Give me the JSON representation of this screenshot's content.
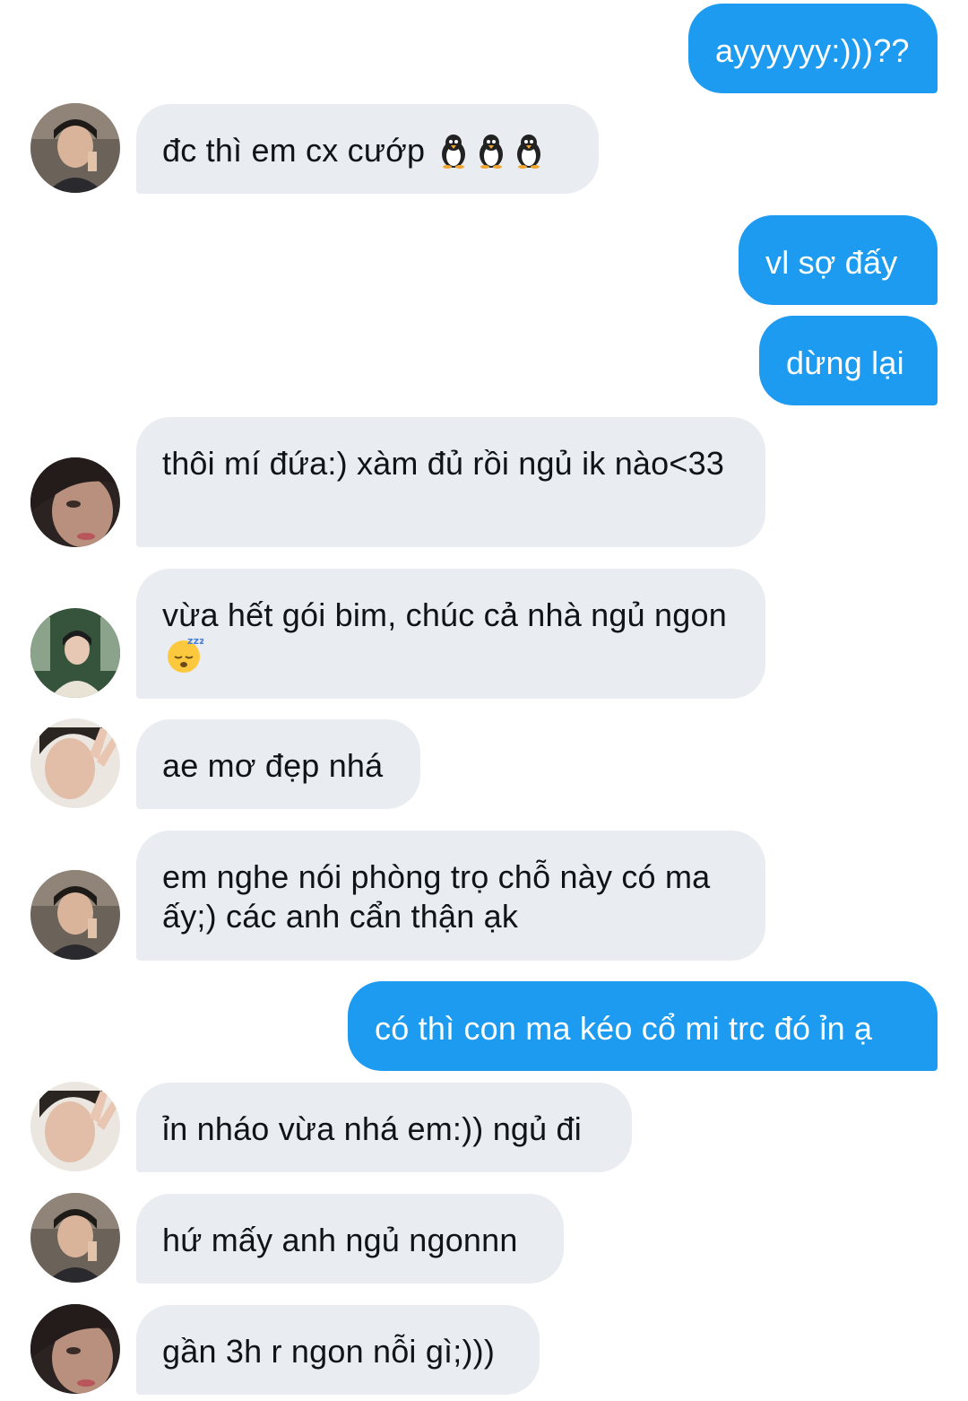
{
  "conversation": {
    "messages": [
      {
        "id": 1,
        "direction": "sent",
        "text": "ayyyyyy:)))??"
      },
      {
        "id": 2,
        "direction": "received",
        "text": "đc thì em cx cướp",
        "emoji": [
          "penguin",
          "penguin",
          "penguin"
        ],
        "avatar": "avatar-a"
      },
      {
        "id": 3,
        "direction": "sent",
        "text": "vl sợ đấy"
      },
      {
        "id": 4,
        "direction": "sent",
        "text": "dừng lại"
      },
      {
        "id": 5,
        "direction": "received",
        "text": "thôi mí đứa:) xàm đủ rồi ngủ ik nào<33",
        "avatar": "avatar-b"
      },
      {
        "id": 6,
        "direction": "received",
        "text": "vừa hết gói bim, chúc cả nhà ngủ ngon",
        "emoji": [
          "sleeping-face"
        ],
        "avatar": "avatar-c"
      },
      {
        "id": 7,
        "direction": "received",
        "text": "ae mơ đẹp nhá",
        "avatar": "avatar-d"
      },
      {
        "id": 8,
        "direction": "received",
        "text": "em nghe nói phòng trọ chỗ này có ma ấy;) các anh cẩn thận ạk",
        "avatar": "avatar-a"
      },
      {
        "id": 9,
        "direction": "sent",
        "text": "có thì con ma kéo cổ mi trc đó ỉn ạ"
      },
      {
        "id": 10,
        "direction": "received",
        "text": "ỉn nháo vừa nhá em:)) ngủ đi",
        "avatar": "avatar-d"
      },
      {
        "id": 11,
        "direction": "received",
        "text": "hứ mấy anh ngủ ngonnn",
        "avatar": "avatar-a"
      },
      {
        "id": 12,
        "direction": "received",
        "text": "gần 3h r ngon nỗi gì;)))",
        "avatar": "avatar-b"
      }
    ]
  },
  "colors": {
    "sent_bubble": "#1d9bf0",
    "sent_text": "#ffffff",
    "received_bubble": "#e9ecf0",
    "received_text": "#0f1419",
    "background": "#ffffff"
  }
}
